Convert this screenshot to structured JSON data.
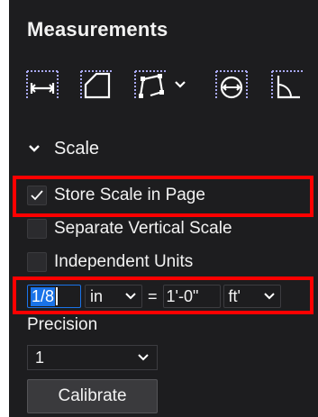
{
  "panel": {
    "title": "Measurements"
  },
  "toolbar": {
    "tools": [
      "length-tool-icon",
      "area-tool-icon",
      "polyline-tool-icon",
      "diameter-tool-icon",
      "angle-tool-icon"
    ]
  },
  "scale_section": {
    "label": "Scale",
    "expanded": true
  },
  "options": {
    "store_scale": {
      "label": "Store Scale in Page",
      "checked": true
    },
    "separate_vertical": {
      "label": "Separate Vertical Scale",
      "checked": false
    },
    "independent_units": {
      "label": "Independent Units",
      "checked": false
    }
  },
  "scale": {
    "page_value": "1/8",
    "page_unit": "in",
    "equals": "=",
    "world_value": "1'-0\"",
    "world_unit": "ft'"
  },
  "precision": {
    "label": "Precision",
    "value": "1"
  },
  "calibrate": {
    "label": "Calibrate"
  },
  "colors": {
    "panel_bg": "#1d1d1f",
    "highlight": "#ff0000",
    "selection": "#1a73e8"
  }
}
